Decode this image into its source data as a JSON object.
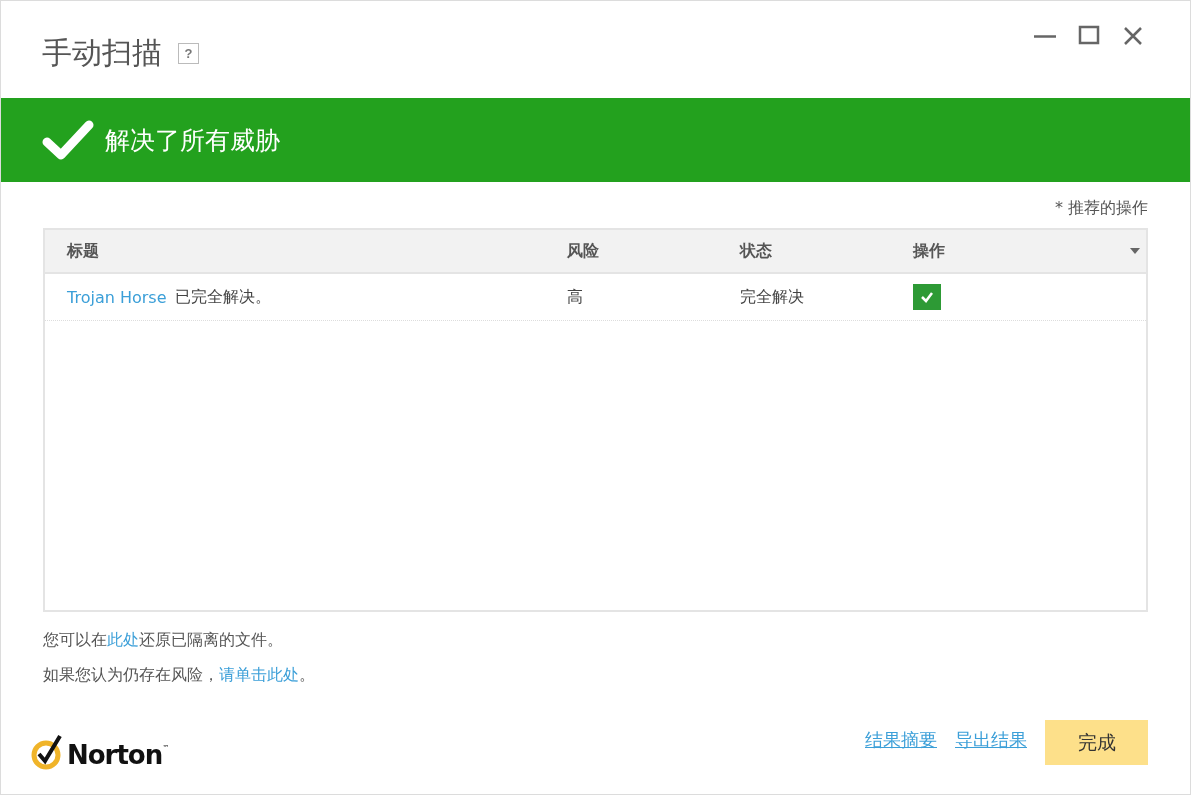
{
  "window": {
    "title": "手动扫描",
    "help": "?"
  },
  "banner": {
    "text": "解决了所有威胁"
  },
  "note": "* 推荐的操作",
  "table": {
    "columns": [
      "标题",
      "风险",
      "状态",
      "操作"
    ],
    "rows": [
      {
        "threat": "Trojan Horse",
        "message": "已完全解决。",
        "risk": "高",
        "status": "完全解决",
        "checked": true
      }
    ]
  },
  "info_lines": [
    {
      "before": "您可以在",
      "link": "此处",
      "after": "还原已隔离的文件。"
    },
    {
      "before": "如果您认为仍存在风险，",
      "link": "请单击此处",
      "after": "。"
    }
  ],
  "logo": {
    "text": "Norton",
    "mark": "™"
  },
  "footer_links": [
    "结果摘要",
    "导出结果"
  ],
  "done_button": "完成"
}
